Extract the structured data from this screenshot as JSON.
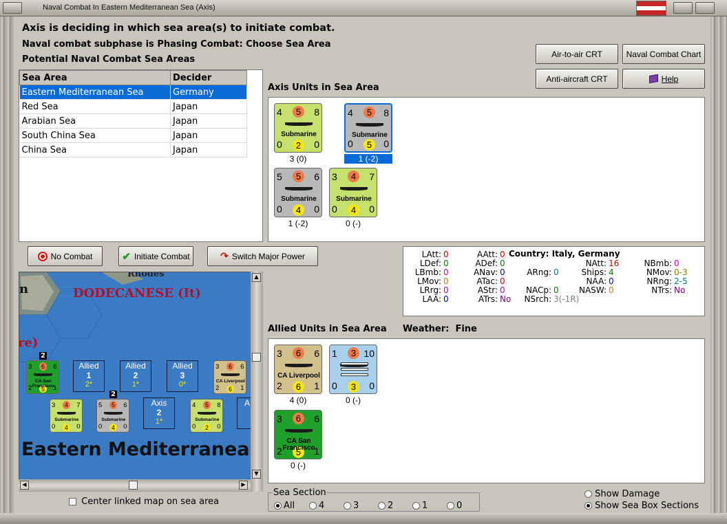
{
  "window": {
    "title": "Naval Combat In Eastern Mediterranean Sea (Axis)"
  },
  "header": {
    "line1": "Axis is deciding in which sea area(s) to initiate combat.",
    "line2": "Naval combat subphase is Phasing Combat: Choose Sea Area",
    "line3": "Potential Naval Combat Sea Areas"
  },
  "buttons": {
    "air_to_air": "Air-to-air CRT",
    "naval_chart": "Naval Combat Chart",
    "anti_aircraft": "Anti-aircraft CRT",
    "help": "Help",
    "no_combat": "No Combat",
    "initiate": "Initiate Combat",
    "switch_power": "Switch Major Power"
  },
  "sea_table": {
    "col_area": "Sea Area",
    "col_decider": "Decider",
    "rows": [
      {
        "area": "Eastern Mediterranean Sea",
        "decider": "Germany"
      },
      {
        "area": "Red Sea",
        "decider": "Japan"
      },
      {
        "area": "Arabian Sea",
        "decider": "Japan"
      },
      {
        "area": "South China Sea",
        "decider": "Japan"
      },
      {
        "area": "China Sea",
        "decider": "Japan"
      }
    ]
  },
  "axis_panel": {
    "label": "Axis Units in Sea Area",
    "units": [
      {
        "tl": "4",
        "tc": "5",
        "tr": "8",
        "type": "Submarine",
        "bl": "0",
        "bc": "2",
        "br": "0",
        "caption": "3 (0)",
        "color": "#c5e06c"
      },
      {
        "tl": "4",
        "tc": "5",
        "tr": "8",
        "type": "Submarine",
        "bl": "0",
        "bc": "5",
        "br": "0",
        "caption": "1 (-2)",
        "color": "#b8b8b8"
      },
      {
        "tl": "5",
        "tc": "5",
        "tr": "6",
        "type": "Submarine",
        "bl": "0",
        "bc": "4",
        "br": "0",
        "caption": "1 (-2)",
        "color": "#b8b8b8"
      },
      {
        "tl": "3",
        "tc": "4",
        "tr": "7",
        "type": "Submarine",
        "bl": "0",
        "bc": "4",
        "br": "0",
        "caption": "0 (-)",
        "color": "#c5e06c"
      }
    ]
  },
  "stats": {
    "country_label": "Country:",
    "country_value": "Italy, Germany",
    "items": [
      {
        "k": "LAtt:",
        "v": "0",
        "c": "#d00000"
      },
      {
        "k": "LDef:",
        "v": "0",
        "c": "#008000"
      },
      {
        "k": "LBmb:",
        "v": "0",
        "c": "#c000c0"
      },
      {
        "k": "LMov:",
        "v": "0",
        "c": "#c08000"
      },
      {
        "k": "LRrg:",
        "v": "0",
        "c": "#c000c0"
      },
      {
        "k": "LAA:",
        "v": "0",
        "c": "#0000c0"
      },
      {
        "k": "AAtt:",
        "v": "0",
        "c": "#d00000"
      },
      {
        "k": "ADef:",
        "v": "0",
        "c": "#008000"
      },
      {
        "k": "ANav:",
        "v": "0",
        "c": "#0000c0"
      },
      {
        "k": "ATac:",
        "v": "0",
        "c": "#d00000"
      },
      {
        "k": "AStr:",
        "v": "0",
        "c": "#c000c0"
      },
      {
        "k": "ATrs:",
        "v": "No",
        "c": "#800080"
      },
      {
        "k": "ARng:",
        "v": "0",
        "c": "#008080"
      },
      {
        "k": "NACp:",
        "v": "0",
        "c": "#008000"
      },
      {
        "k": "NSrch:",
        "v": "3(-1R)",
        "c": "#808080"
      },
      {
        "k": "NAtt:",
        "v": "16",
        "c": "#d00000"
      },
      {
        "k": "Ships:",
        "v": "4",
        "c": "#008000"
      },
      {
        "k": "NAA:",
        "v": "0",
        "c": "#0000c0"
      },
      {
        "k": "NASW:",
        "v": "0",
        "c": "#c08000"
      },
      {
        "k": "NBmb:",
        "v": "0",
        "c": "#c000c0"
      },
      {
        "k": "NMov:",
        "v": "0-3",
        "c": "#808000"
      },
      {
        "k": "NRng:",
        "v": "2-5",
        "c": "#008080"
      },
      {
        "k": "NTrs:",
        "v": "No",
        "c": "#800080"
      }
    ]
  },
  "allied_panel": {
    "label": "Allied Units in Sea Area",
    "weather_label": "Weather:",
    "weather_value": "Fine",
    "units": [
      {
        "tl": "3",
        "tc": "6",
        "tr": "6",
        "type": "CA Liverpool",
        "bl": "2",
        "bc": "6",
        "br": "1",
        "caption": "4 (0)",
        "color": "#d2c08c"
      },
      {
        "tl": "1",
        "tc": "3",
        "tr": "10",
        "type": "",
        "bl": "0",
        "bc": "3",
        "br": "0",
        "caption": "0 (-)",
        "color": "#a8d0ec"
      },
      {
        "tl": "3",
        "tc": "6",
        "tr": "6",
        "type": "CA San Francisco",
        "bl": "2",
        "bc": "5",
        "br": "1",
        "caption": "0 (-)",
        "color": "#1fa02a"
      }
    ]
  },
  "map": {
    "label_rhodes": "Rhodes",
    "label_dodecanese": "DODECANESE (It)",
    "label_n": "n",
    "label_re": "re)",
    "label_sea": "Eastern Mediterranean",
    "stack_count_1": "2",
    "stack_count_2": "2",
    "allied_boxes": [
      {
        "side": "Allied",
        "num": "1",
        "val": "2*"
      },
      {
        "side": "Allied",
        "num": "2",
        "val": "1*"
      },
      {
        "side": "Allied",
        "num": "3",
        "val": "0*"
      }
    ],
    "axis_box": {
      "side": "Axis",
      "num": "2",
      "val": "1*"
    },
    "axis_box_partial": "A",
    "mini_units": [
      {
        "tl": "3",
        "tc": "6",
        "tr": "6",
        "type": "CA San Francisco",
        "bl": "2",
        "bc": "5",
        "br": "1",
        "color": "#1fa02a"
      },
      {
        "tl": "3",
        "tc": "6",
        "tr": "6",
        "type": "CA Liverpool",
        "bl": "2",
        "bc": "6",
        "br": "1",
        "color": "#d2c08c"
      },
      {
        "tl": "3",
        "tc": "4",
        "tr": "7",
        "type": "Submarine",
        "bl": "0",
        "bc": "4",
        "br": "0",
        "color": "#c5e06c"
      },
      {
        "tl": "5",
        "tc": "5",
        "tr": "6",
        "type": "Submarine",
        "bl": "0",
        "bc": "4",
        "br": "0",
        "color": "#b8b8b8"
      },
      {
        "tl": "4",
        "tc": "5",
        "tr": "8",
        "type": "Submarine",
        "bl": "0",
        "bc": "2",
        "br": "0",
        "color": "#c5e06c"
      }
    ],
    "center_linked": "Center linked map on sea area"
  },
  "sea_section": {
    "label": "Sea Section",
    "options": [
      "All",
      "4",
      "3",
      "2",
      "1",
      "0"
    ],
    "selected": "All"
  },
  "options": {
    "show_damage": "Show Damage",
    "show_sections": "Show Sea Box Sections"
  }
}
